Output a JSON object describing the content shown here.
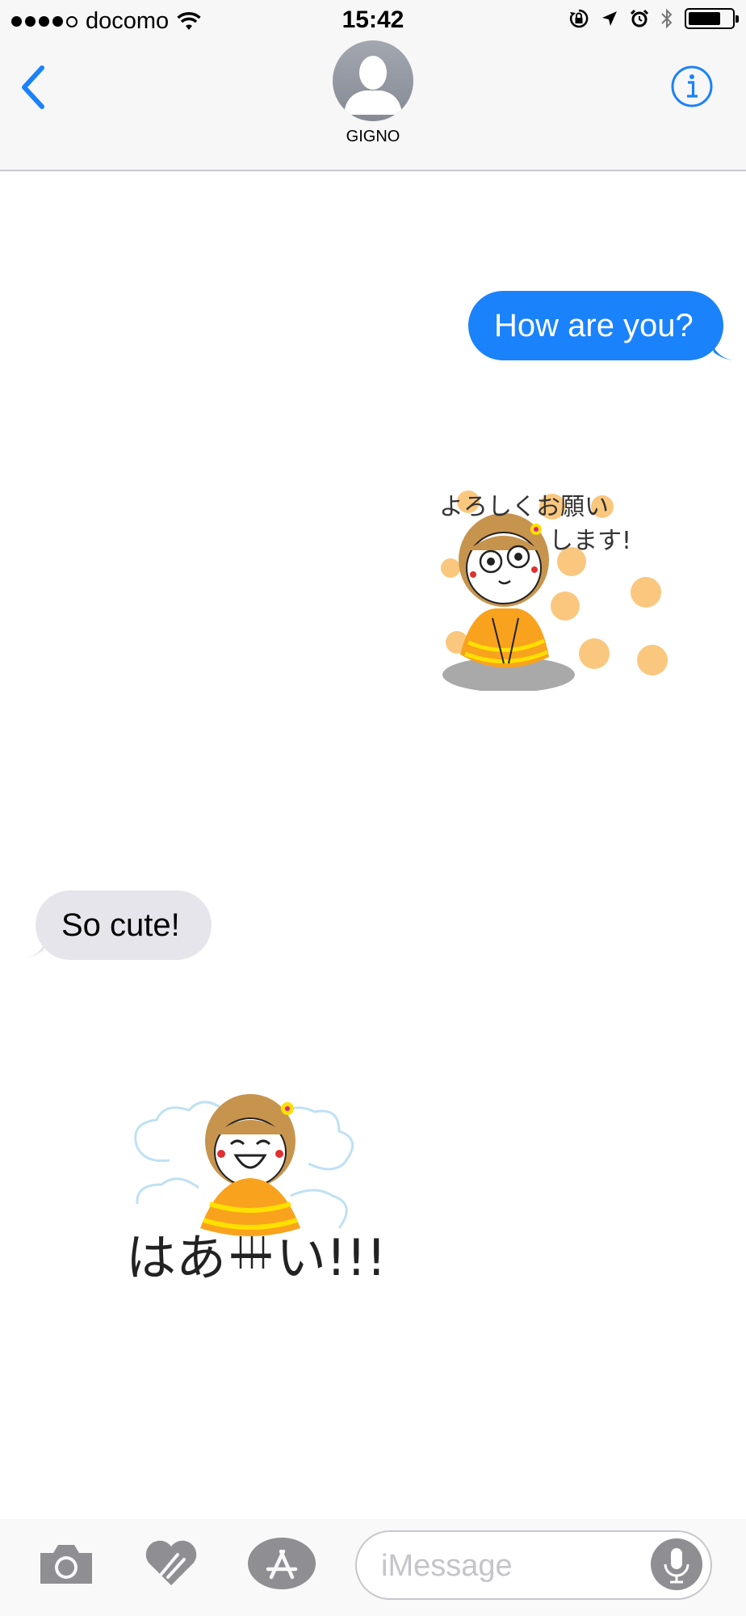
{
  "status_bar": {
    "carrier": "docomo",
    "time": "15:42",
    "signal_bars": 4,
    "signal_total": 5,
    "battery_level": 0.75
  },
  "header": {
    "contact_name": "GIGNO",
    "back_icon": "chevron-left-icon",
    "info_icon": "info-icon",
    "accent_color": "#1a82fb"
  },
  "messages": [
    {
      "direction": "outgoing",
      "type": "text",
      "text": "How are you?"
    },
    {
      "direction": "outgoing",
      "type": "sticker",
      "sticker_text": "よろしくお願いします!"
    },
    {
      "direction": "incoming",
      "type": "text",
      "text": "So cute!"
    },
    {
      "direction": "incoming",
      "type": "sticker",
      "sticker_text": "はあーい!!!"
    }
  ],
  "input_bar": {
    "placeholder": "iMessage",
    "camera_icon": "camera-icon",
    "digital_touch_icon": "heart-hands-icon",
    "app_store_icon": "app-store-icon",
    "mic_icon": "microphone-icon"
  }
}
